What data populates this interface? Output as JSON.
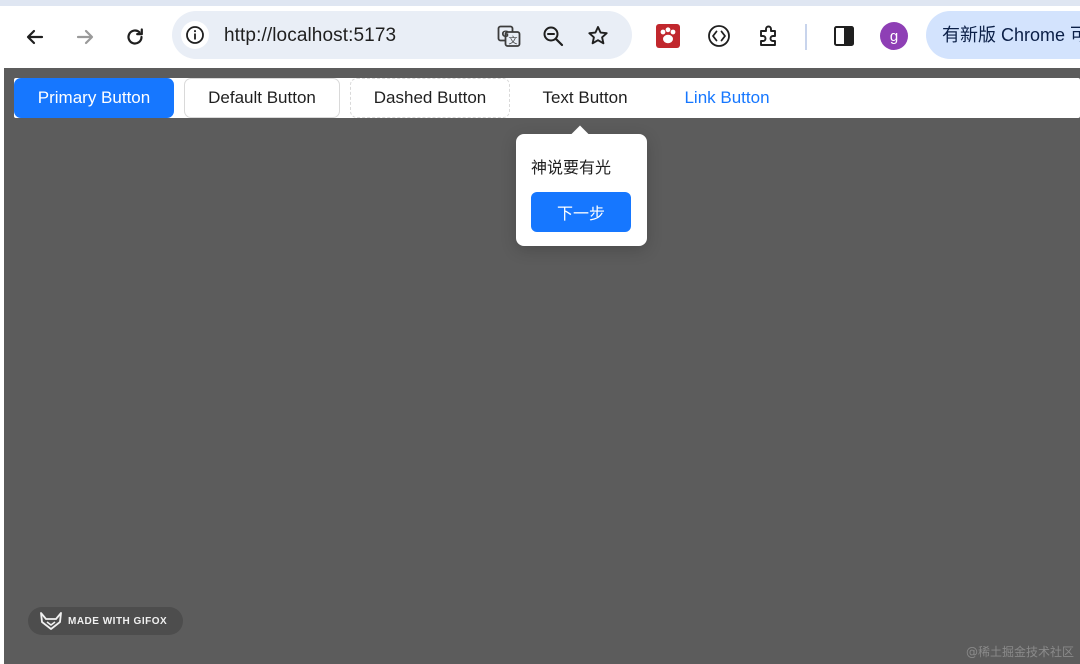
{
  "browser": {
    "url": "http://localhost:5173",
    "update_label": "有新版 Chrome 可",
    "profile_initial": "g",
    "icons": {
      "back": "arrow-left-icon",
      "forward": "arrow-right-icon",
      "reload": "reload-icon",
      "site_info": "info-icon",
      "translate": "translate-icon",
      "zoom": "zoom-out-icon",
      "bookmark": "star-icon",
      "extension_1": "paw-extension-icon",
      "extension_2": "code-extension-icon",
      "extensions": "puzzle-icon",
      "side_panel": "side-panel-icon"
    }
  },
  "page": {
    "buttons": {
      "primary": "Primary Button",
      "default": "Default Button",
      "dashed": "Dashed Button",
      "text": "Text Button",
      "link": "Link Button"
    },
    "tour": {
      "description": "神说要有光",
      "next_label": "下一步"
    }
  },
  "overlays": {
    "gifox_label": "MADE WITH GIFOX",
    "watermark": "@稀土掘金技术社区"
  },
  "colors": {
    "primary": "#1677ff",
    "page_background": "#5c5c5c",
    "update_pill": "#d3e3fd"
  }
}
